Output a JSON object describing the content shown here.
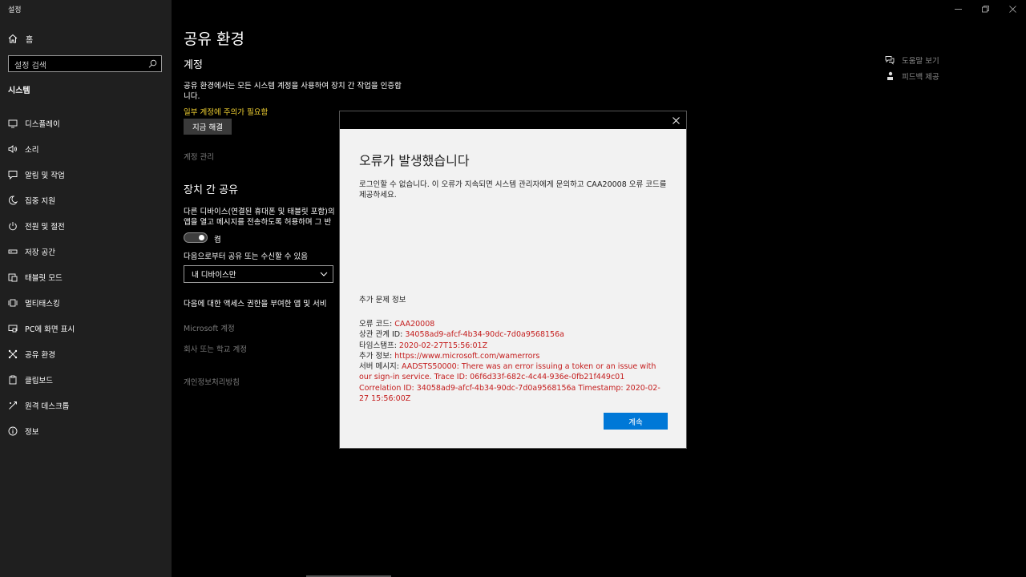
{
  "window": {
    "title": "설정"
  },
  "sidebar": {
    "home_label": "홈",
    "search_placeholder": "설정 검색",
    "section": "시스템",
    "items": [
      {
        "label": "디스플레이",
        "icon": "monitor-icon"
      },
      {
        "label": "소리",
        "icon": "speaker-icon"
      },
      {
        "label": "알림 및 작업",
        "icon": "notification-icon"
      },
      {
        "label": "집중 지원",
        "icon": "moon-icon"
      },
      {
        "label": "전원 및 절전",
        "icon": "power-icon"
      },
      {
        "label": "저장 공간",
        "icon": "storage-icon"
      },
      {
        "label": "태블릿 모드",
        "icon": "tablet-icon"
      },
      {
        "label": "멀티태스킹",
        "icon": "multitasking-icon"
      },
      {
        "label": "PC에 화면 표시",
        "icon": "project-icon"
      },
      {
        "label": "공유 환경",
        "icon": "shared-experiences-icon"
      },
      {
        "label": "클립보드",
        "icon": "clipboard-icon"
      },
      {
        "label": "원격 데스크톱",
        "icon": "remote-desktop-icon"
      },
      {
        "label": "정보",
        "icon": "info-icon"
      }
    ]
  },
  "main": {
    "title": "공유 환경",
    "accounts_heading": "계정",
    "accounts_desc_1": "공유 환경에서는 모든 시스템 계정을 사용하여 장치 간 작업을 인증합",
    "accounts_desc_2": "니다.",
    "warning_link": "일부 계정에 주의가 필요함",
    "fix_button": "지금 해결",
    "manage_accounts": "계정 관리",
    "share_heading": "장치 간 공유",
    "share_desc_1": "다른 디바이스(연결된 휴대폰 및 태블릿 포함)의",
    "share_desc_2": "앱을 열고 메시지를 전송하도록 허용하며 그 반",
    "toggle_label": "켬",
    "share_from_label": "다음으로부터 공유 또는 수신할 수 있음",
    "share_from_value": "내 디바이스만",
    "access_desc": "다음에 대한 액세스 권한을 부여한 앱 및 서비",
    "ms_account": "Microsoft 계정",
    "work_account": "회사 또는 학교 계정",
    "privacy": "개인정보처리방침"
  },
  "help": {
    "get_help": "도움말 보기",
    "feedback": "피드백 제공"
  },
  "dialog": {
    "title": "오류가 발생했습니다",
    "message": "로그인할 수 없습니다. 이 오류가 지속되면 시스템 관리자에게 문의하고 CAA20008 오류 코드를 제공하세요.",
    "more_info": "추가 문제 정보",
    "error_code_label": "오류 코드: ",
    "error_code": "CAA20008",
    "correlation_label": "상관 관계 ID: ",
    "correlation_id": "34058ad9-afcf-4b34-90dc-7d0a9568156a",
    "timestamp_label": "타임스탬프: ",
    "timestamp": "2020-02-27T15:56:01Z",
    "more_label": "추가 정보: ",
    "more_url": "https://www.microsoft.com/wamerrors",
    "server_label": "서버 메시지: ",
    "server_message": "AADSTS50000: There was an error issuing a token or an issue with our sign-in service. Trace ID: 06f6d33f-682c-4c44-936e-0fb21f449c01 Correlation ID: 34058ad9-afcf-4b34-90dc-7d0a9568156a Timestamp: 2020-02-27 15:56:00Z",
    "continue_button": "계속"
  },
  "colors": {
    "accent": "#0078d7",
    "warning": "#f2d232",
    "error": "#c41d1d"
  }
}
